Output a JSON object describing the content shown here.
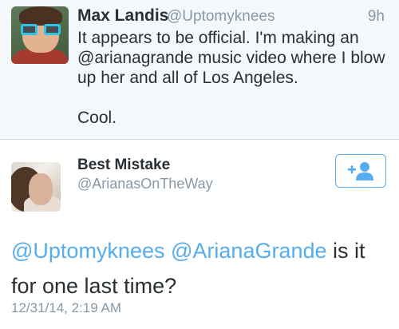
{
  "tweet1": {
    "name": "Max Landis",
    "handle": "@Uptomyknees",
    "time": "9h",
    "lines": [
      "It appears to be official.  I'm making an",
      "@arianagrande music video where I blow",
      "up her and all of Los Angeles."
    ],
    "closing": "Cool."
  },
  "tweet2": {
    "name": "Best Mistake",
    "handle": "@ArianasOnTheWay",
    "mention1": "@Uptomyknees",
    "mention2": "@ArianaGrande",
    "text_after_mentions": " is it",
    "text_line2": "for one last time?",
    "timestamp": "12/31/14, 2:19 AM"
  },
  "follow_button": {
    "icon": "add-user-icon"
  },
  "colors": {
    "accent": "#55acee",
    "text": "#292f33",
    "muted": "#8899a6",
    "top_bg": "#f5f8fa"
  }
}
